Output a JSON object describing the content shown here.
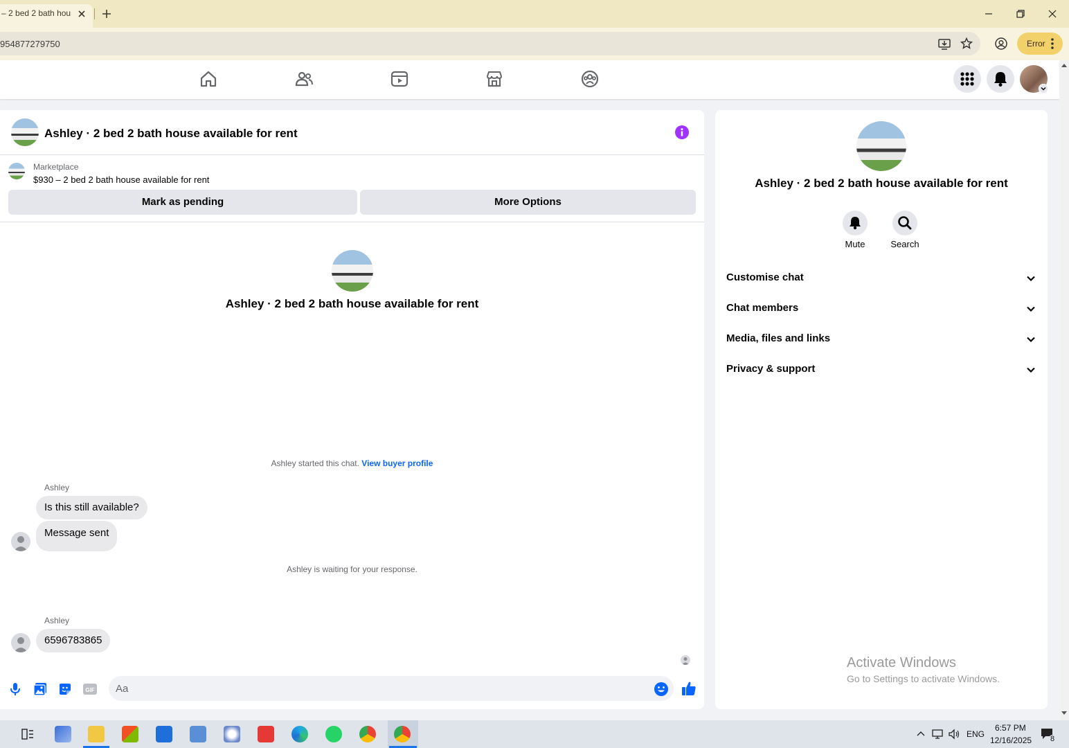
{
  "browser": {
    "tab_title": "– 2 bed 2 bath hou",
    "url": "954877279750",
    "error_label": "Error"
  },
  "conversation": {
    "title": "Ashley · 2 bed 2 bath house available for rent",
    "marketplace_label": "Marketplace",
    "listing": "$930 – 2 bed 2 bath house available for rent",
    "mark_pending_label": "Mark as pending",
    "more_options_label": "More Options",
    "center_title": "Ashley · 2 bed 2 bath house available for rent",
    "started_text": "Ashley started this chat.",
    "view_profile_link": "View buyer profile",
    "waiting_text": "Ashley is waiting for your response."
  },
  "messages": [
    {
      "sender": "Ashley",
      "text": "Is this still available?"
    },
    {
      "sender": "",
      "text": "Message sent"
    },
    {
      "sender": "Ashley",
      "text": "6596783865"
    }
  ],
  "composer": {
    "placeholder": "Aa"
  },
  "details_panel": {
    "title": "Ashley · 2 bed 2 bath house available for rent",
    "mute_label": "Mute",
    "search_label": "Search",
    "sections": [
      "Customise chat",
      "Chat members",
      "Media, files and links",
      "Privacy & support"
    ]
  },
  "watermark": {
    "line1": "Activate Windows",
    "line2": "Go to Settings to activate Windows."
  },
  "taskbar": {
    "language": "ENG",
    "time": "6:57 PM",
    "date": "12/16/2025",
    "notification_count": "8"
  },
  "colors": {
    "accent": "#0866ff",
    "info_purple": "#a033ff",
    "chrome_tabstrip": "#efe8c2",
    "error_pill": "#f2d16b"
  }
}
